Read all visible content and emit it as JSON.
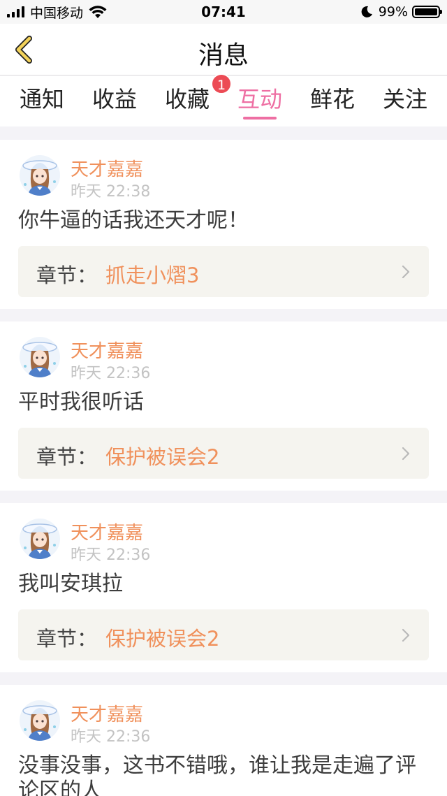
{
  "status_bar": {
    "carrier": "中国移动",
    "time": "07:41",
    "battery_percent": "99%",
    "battery_level": 0.99
  },
  "header": {
    "title": "消息"
  },
  "tabs": [
    {
      "label": "通知"
    },
    {
      "label": "收益"
    },
    {
      "label": "收藏",
      "badge": "1"
    },
    {
      "label": "互动"
    },
    {
      "label": "鲜花"
    },
    {
      "label": "关注"
    }
  ],
  "active_tab": "互动",
  "messages": [
    {
      "user": "天才嘉嘉",
      "time": "昨天 22:38",
      "text": "你牛逼的话我还天才呢！",
      "chapter_label": "章节：",
      "chapter": "抓走小熠3"
    },
    {
      "user": "天才嘉嘉",
      "time": "昨天 22:36",
      "text": "平时我很听话",
      "chapter_label": "章节：",
      "chapter": "保护被误会2"
    },
    {
      "user": "天才嘉嘉",
      "time": "昨天 22:36",
      "text": "我叫安琪拉",
      "chapter_label": "章节：",
      "chapter": "保护被误会2"
    },
    {
      "user": "天才嘉嘉",
      "time": "昨天 22:36",
      "text": "没事没事，这书不错哦，谁让我是走遍了评论区的人"
    }
  ],
  "colors": {
    "accent_pink": "#ee6fa3",
    "name_orange": "#f0915c",
    "badge_red": "#ec4b55",
    "back_arrow_yellow": "#f3d25a"
  },
  "icons": {
    "back": "back-arrow-icon",
    "chapter_arrow": "chevron-right-icon"
  }
}
